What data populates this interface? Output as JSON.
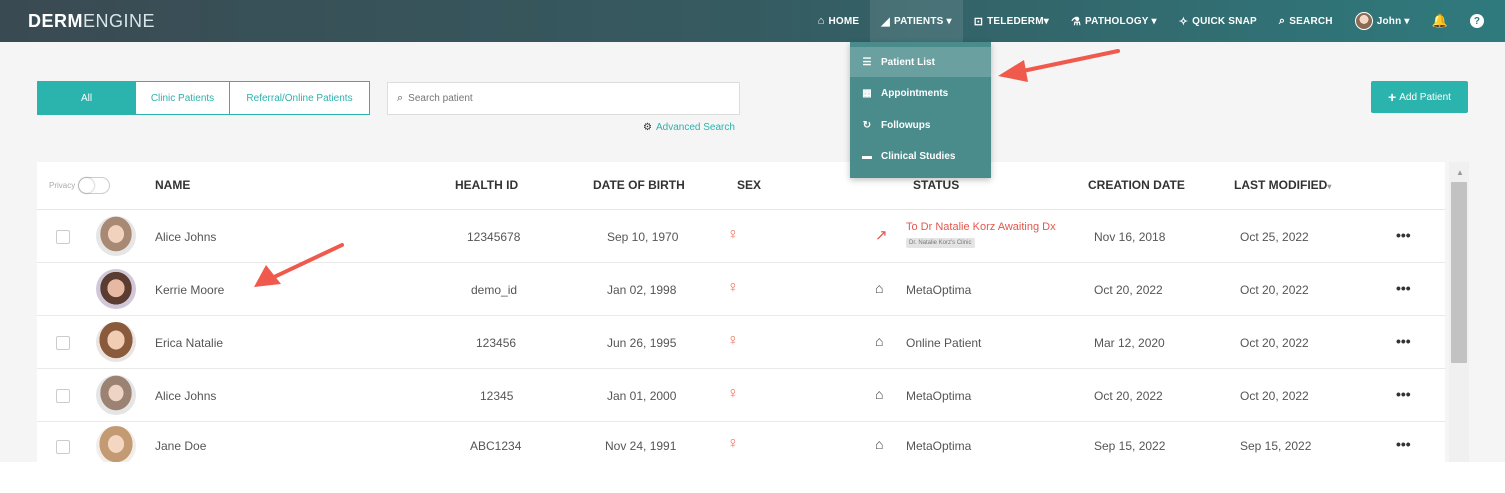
{
  "nav": {
    "logo_bold": "DERM",
    "logo_light": "ENGINE",
    "items": [
      {
        "icon": "home-icon",
        "glyph": "⌂",
        "label": "HOME"
      },
      {
        "icon": "patients-icon",
        "glyph": "◢",
        "label": "PATIENTS ▾"
      },
      {
        "icon": "telederm-icon",
        "glyph": "⊡",
        "label": "TELEDERM▾"
      },
      {
        "icon": "pathology-icon",
        "glyph": "⚗",
        "label": "PATHOLOGY ▾"
      },
      {
        "icon": "camera-icon",
        "glyph": "✧",
        "label": "QUICK SNAP"
      },
      {
        "icon": "search-icon",
        "glyph": "⌕",
        "label": "SEARCH"
      }
    ],
    "user_label": "John ▾",
    "help_glyph": "?"
  },
  "dropdown": {
    "items": [
      {
        "icon": "list-icon",
        "glyph": "☰",
        "label": "Patient List"
      },
      {
        "icon": "calendar-icon",
        "glyph": "▦",
        "label": "Appointments"
      },
      {
        "icon": "followup-icon",
        "glyph": "↻",
        "label": "Followups"
      },
      {
        "icon": "folder-icon",
        "glyph": "▬",
        "label": "Clinical Studies"
      }
    ]
  },
  "filters": {
    "all": "All",
    "clinic": "Clinic Patients",
    "referral": "Referral/Online Patients"
  },
  "search": {
    "placeholder": "Search patient",
    "advanced": "Advanced Search"
  },
  "add_patient": "Add Patient",
  "table": {
    "privacy_label": "Privacy",
    "headers": {
      "name": "NAME",
      "health_id": "HEALTH ID",
      "dob": "DATE OF BIRTH",
      "sex": "SEX",
      "status": "STATUS",
      "creation": "CREATION DATE",
      "modified": "LAST MODIFIED",
      "modified_sort": "▾"
    },
    "rows": [
      {
        "name": "Alice Johns",
        "health_id": "12345678",
        "dob": "Sep 10, 1970",
        "status": "To Dr Natalie Korz Awaiting Dx",
        "status_badge": "Dr. Natalie Korz's Clinic",
        "created": "Nov 16, 2018",
        "modified": "Oct 25, 2022"
      },
      {
        "name": "Kerrie Moore",
        "health_id": "demo_id",
        "dob": "Jan 02, 1998",
        "status": "MetaOptima",
        "created": "Oct 20, 2022",
        "modified": "Oct 20, 2022"
      },
      {
        "name": "Erica Natalie",
        "health_id": "123456",
        "dob": "Jun 26, 1995",
        "status": "Online Patient",
        "created": "Mar 12, 2020",
        "modified": "Oct 20, 2022"
      },
      {
        "name": "Alice Johns",
        "health_id": "12345",
        "dob": "Jan 01, 2000",
        "status": "MetaOptima",
        "created": "Oct 20, 2022",
        "modified": "Oct 20, 2022"
      },
      {
        "name": "Jane Doe",
        "health_id": "ABC1234",
        "dob": "Nov 24, 1991",
        "status": "MetaOptima",
        "created": "Sep 15, 2022",
        "modified": "Sep 15, 2022"
      }
    ],
    "more_glyph": "•••",
    "sex_glyph": "♀"
  },
  "colors": {
    "accent": "#2bb3ad",
    "alert": "#e2574c",
    "annotation": "#ef5a4c"
  }
}
